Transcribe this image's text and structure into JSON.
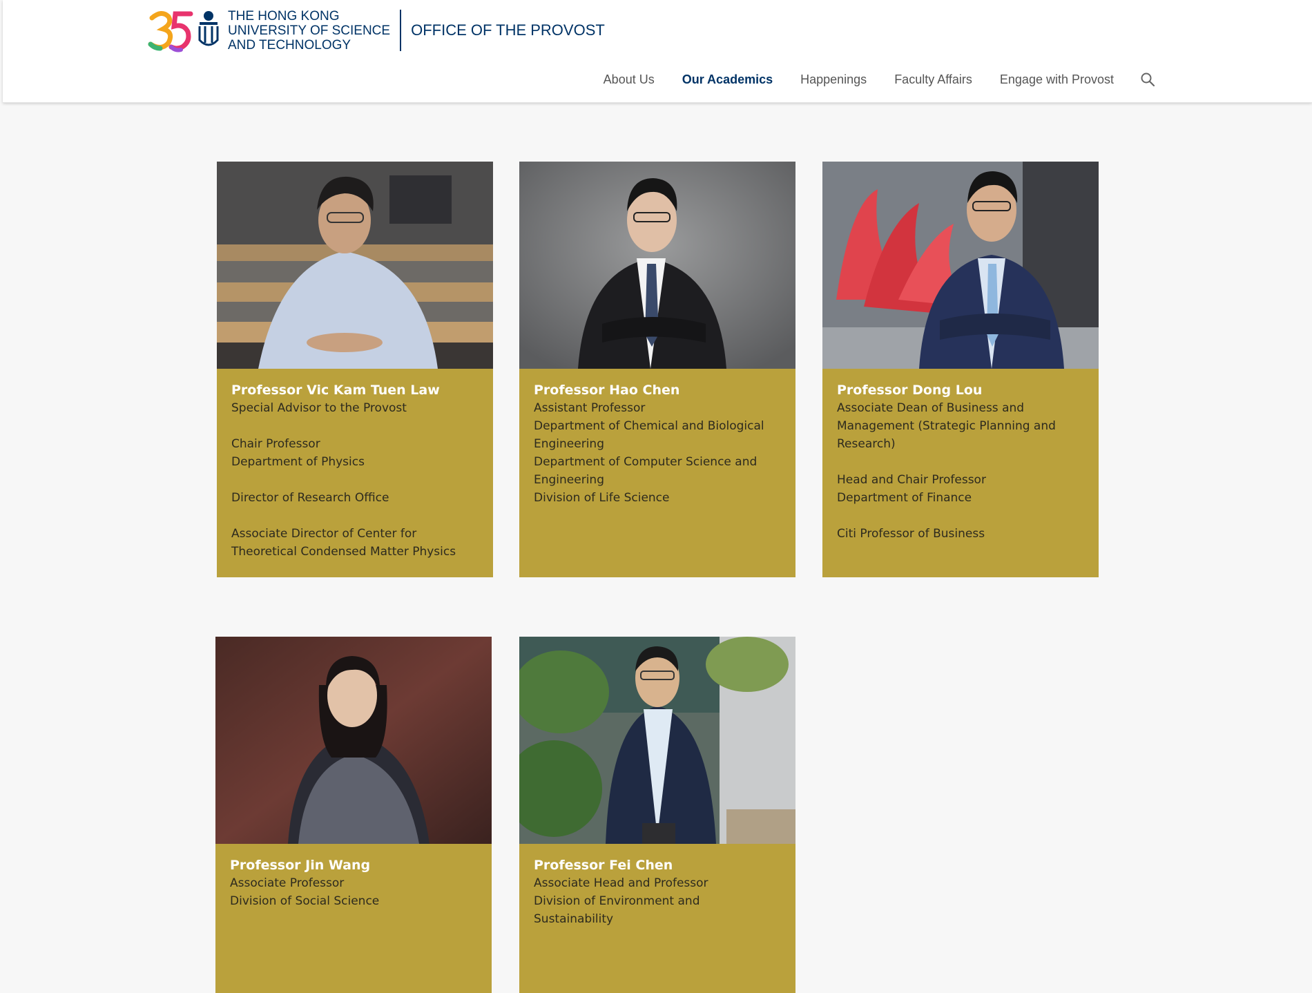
{
  "header": {
    "university_lines": [
      "THE HONG KONG",
      "UNIVERSITY OF SCIENCE",
      "AND TECHNOLOGY"
    ],
    "office_title": "OFFICE OF THE PROVOST",
    "logo_anniversary": "35"
  },
  "nav": {
    "items": [
      {
        "label": "About Us",
        "active": false
      },
      {
        "label": "Our Academics",
        "active": true
      },
      {
        "label": "Happenings",
        "active": false
      },
      {
        "label": "Faculty Affairs",
        "active": false
      },
      {
        "label": "Engage with Provost",
        "active": false
      }
    ],
    "search_icon": "search-icon"
  },
  "cards": [
    {
      "name": "Professor Vic Kam Tuen Law",
      "groups": [
        [
          "Special Advisor to the Provost"
        ],
        [
          "Chair Professor",
          "Department of Physics"
        ],
        [
          "Director of Research Office"
        ],
        [
          "Associate Director of Center for",
          "Theoretical Condensed Matter Physics"
        ]
      ]
    },
    {
      "name": "Professor Hao Chen",
      "groups": [
        [
          "Assistant Professor",
          "Department of Chemical and Biological",
          "Engineering",
          "Department of Computer Science and",
          "Engineering",
          "Division of Life Science"
        ]
      ]
    },
    {
      "name": "Professor Dong Lou",
      "groups": [
        [
          "Associate Dean of Business and",
          "Management (Strategic Planning and",
          "Research)"
        ],
        [
          "Head and Chair Professor",
          "Department of Finance"
        ],
        [
          "Citi Professor of Business"
        ]
      ]
    },
    {
      "name": "Professor Jin Wang",
      "groups": [
        [
          "Associate Professor",
          "Division of Social Science"
        ]
      ]
    },
    {
      "name": "Professor Fei Chen",
      "groups": [
        [
          "Associate Head and Professor",
          "Division of Environment and Sustainability"
        ]
      ]
    }
  ]
}
